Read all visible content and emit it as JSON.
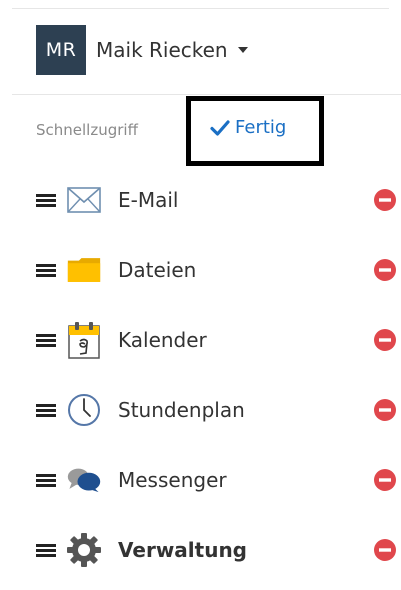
{
  "user": {
    "initials": "MR",
    "name": "Maik Riecken"
  },
  "quick_access": {
    "label": "Schnellzugriff",
    "done_label": "Fertig"
  },
  "items": [
    {
      "label": "E-Mail",
      "icon": "envelope-icon"
    },
    {
      "label": "Dateien",
      "icon": "folder-icon"
    },
    {
      "label": "Kalender",
      "icon": "calendar-icon"
    },
    {
      "label": "Stundenplan",
      "icon": "clock-icon"
    },
    {
      "label": "Messenger",
      "icon": "chat-bubbles-icon"
    },
    {
      "label": "Verwaltung",
      "icon": "gear-icon"
    }
  ],
  "colors": {
    "avatar_bg": "#2d4052",
    "link_blue": "#1a6fc4",
    "remove_red": "#e0474c",
    "folder_yellow": "#ffc000"
  }
}
